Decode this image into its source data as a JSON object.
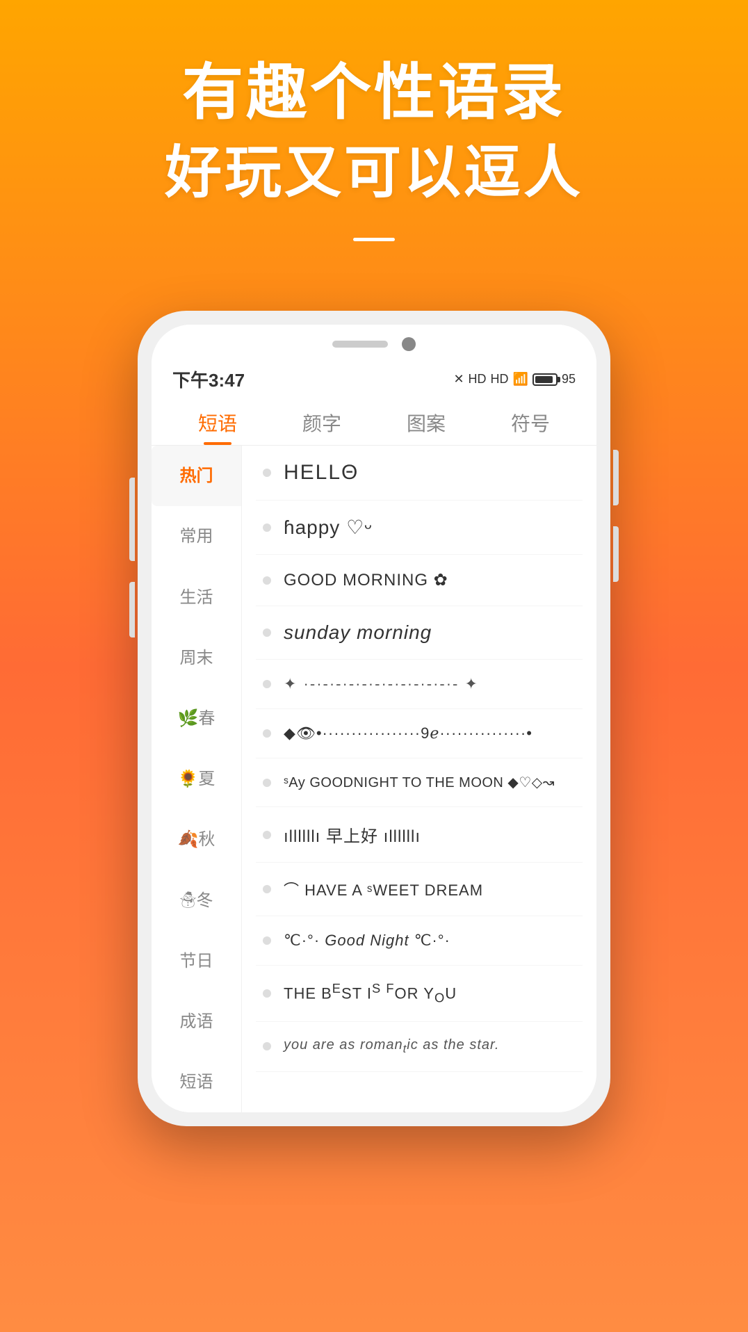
{
  "app": {
    "background_gradient_start": "#FFA500",
    "background_gradient_end": "#FF6B35"
  },
  "header": {
    "headline1": "有趣个性语录",
    "headline2": "好玩又可以逗人"
  },
  "phone": {
    "status_bar": {
      "time": "下午3:47",
      "signal_label": "HD HD",
      "battery_percent": "95"
    },
    "tabs": [
      {
        "label": "短语",
        "active": true
      },
      {
        "label": "颜字",
        "active": false
      },
      {
        "label": "图案",
        "active": false
      },
      {
        "label": "符号",
        "active": false
      }
    ],
    "sidebar": [
      {
        "label": "热门",
        "active": true
      },
      {
        "label": "常用",
        "active": false
      },
      {
        "label": "生活",
        "active": false
      },
      {
        "label": "周末",
        "active": false
      },
      {
        "label": "🌿春",
        "active": false
      },
      {
        "label": "🌻夏",
        "active": false
      },
      {
        "label": "🍂秋",
        "active": false
      },
      {
        "label": "☃冬",
        "active": false
      },
      {
        "label": "节日",
        "active": false
      },
      {
        "label": "成语",
        "active": false
      },
      {
        "label": "短语",
        "active": false
      }
    ],
    "list_items": [
      {
        "text": "HELLΘ"
      },
      {
        "text": "ɦappy ♡ᵕ"
      },
      {
        "text": "GOOD MORNING ✿"
      },
      {
        "text": "sunday morning"
      },
      {
        "text": "✦ ·····················--···················---- ✦"
      },
      {
        "text": "◆👁• --------------------9ℯ-------------- •"
      },
      {
        "text": "ˢAy GOODNIGHT TO THE MOON ◆♡◇↝"
      },
      {
        "text": "ıllllllı 早上好 ıllllllı"
      },
      {
        "text": "⌒ HAVE A ˢWEET DREAM"
      },
      {
        "text": "℃·°· Good Night ℃·°·"
      },
      {
        "text": "THE BEST IS FOR YOU"
      },
      {
        "text": "you are as romantic as the star"
      }
    ]
  }
}
